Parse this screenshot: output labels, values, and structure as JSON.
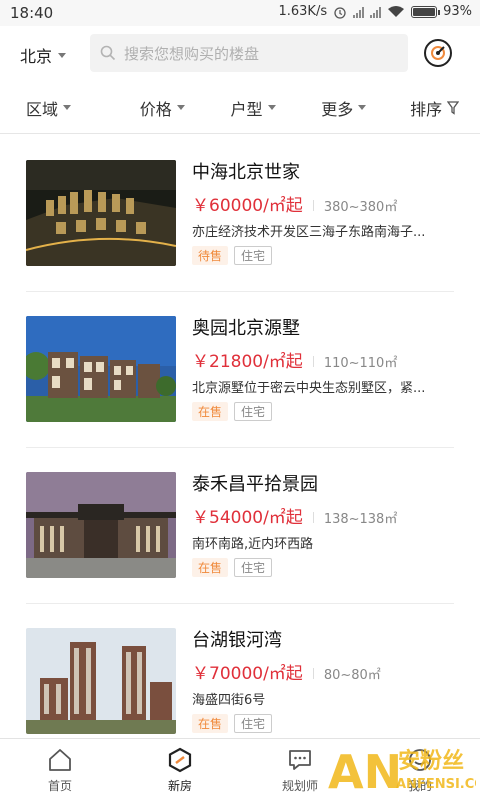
{
  "status_bar": {
    "time": "18:40",
    "speed": "1.63K/s",
    "battery": "93%"
  },
  "header": {
    "city": "北京",
    "search_placeholder": "搜索您想购买的楼盘"
  },
  "filters": [
    {
      "label": "区域"
    },
    {
      "label": "价格"
    },
    {
      "label": "户型"
    },
    {
      "label": "更多"
    },
    {
      "label": "排序"
    }
  ],
  "listings": [
    {
      "name": "中海北京世家",
      "price": "￥60000/㎡起",
      "area": "380~380㎡",
      "address": "亦庄经济技术开发区三海子东路南海子...",
      "status": "待售",
      "type": "住宅"
    },
    {
      "name": "奥园北京源墅",
      "price": "￥21800/㎡起",
      "area": "110~110㎡",
      "address": "北京源墅位于密云中央生态别墅区，紧...",
      "status": "在售",
      "type": "住宅"
    },
    {
      "name": "泰禾昌平拾景园",
      "price": "￥54000/㎡起",
      "area": "138~138㎡",
      "address": "南环南路,近内环西路",
      "status": "在售",
      "type": "住宅"
    },
    {
      "name": "台湖银河湾",
      "price": "￥70000/㎡起",
      "area": "80~80㎡",
      "address": "海盛四街6号",
      "status": "在售",
      "type": "住宅"
    }
  ],
  "bottom_nav": [
    {
      "label": "首页",
      "icon": "home-icon"
    },
    {
      "label": "新房",
      "icon": "new-home-icon"
    },
    {
      "label": "规划师",
      "icon": "chat-icon"
    },
    {
      "label": "我的",
      "icon": "profile-icon"
    }
  ],
  "watermark": {
    "text": "安粉丝",
    "sub": "ANFENSI.COM",
    "logo": "AN"
  },
  "colors": {
    "price": "#e0303a",
    "status_tag": "#f08a3c",
    "watermark": "#f1b81a"
  }
}
